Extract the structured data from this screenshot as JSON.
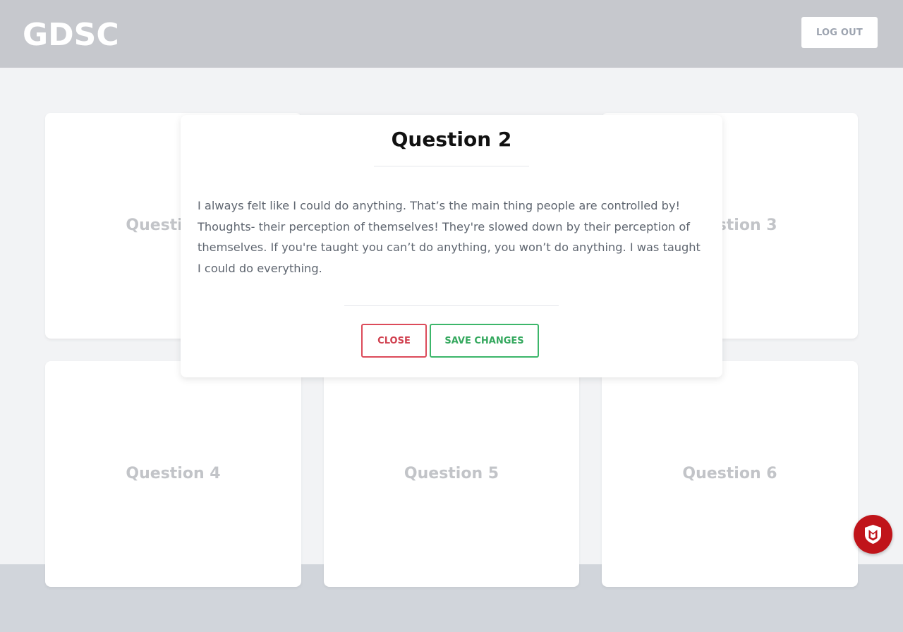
{
  "header": {
    "logo": "GDSC",
    "logout_label": "LOG OUT"
  },
  "cards": [
    {
      "label": "Question 1"
    },
    {
      "label": "Question 2"
    },
    {
      "label": "Question 3"
    },
    {
      "label": "Question 4"
    },
    {
      "label": "Question 5"
    },
    {
      "label": "Question 6"
    }
  ],
  "modal": {
    "title": "Question 2",
    "body": "I always felt like I could do anything. That’s the main thing people are controlled by! Thoughts- their perception of themselves! They're slowed down by their perception of themselves. If you're taught you can’t do anything, you won’t do anything. I was taught I could do everything.",
    "close_label": "CLOSE",
    "save_label": "SAVE CHANGES"
  },
  "colors": {
    "header_bg": "#c6c8cd",
    "page_bg": "#f2f3f5",
    "close_accent": "#dc4b5a",
    "save_accent": "#3cb66a",
    "badge_red": "#c0141a"
  },
  "icons": {
    "badge": "shield-icon"
  }
}
